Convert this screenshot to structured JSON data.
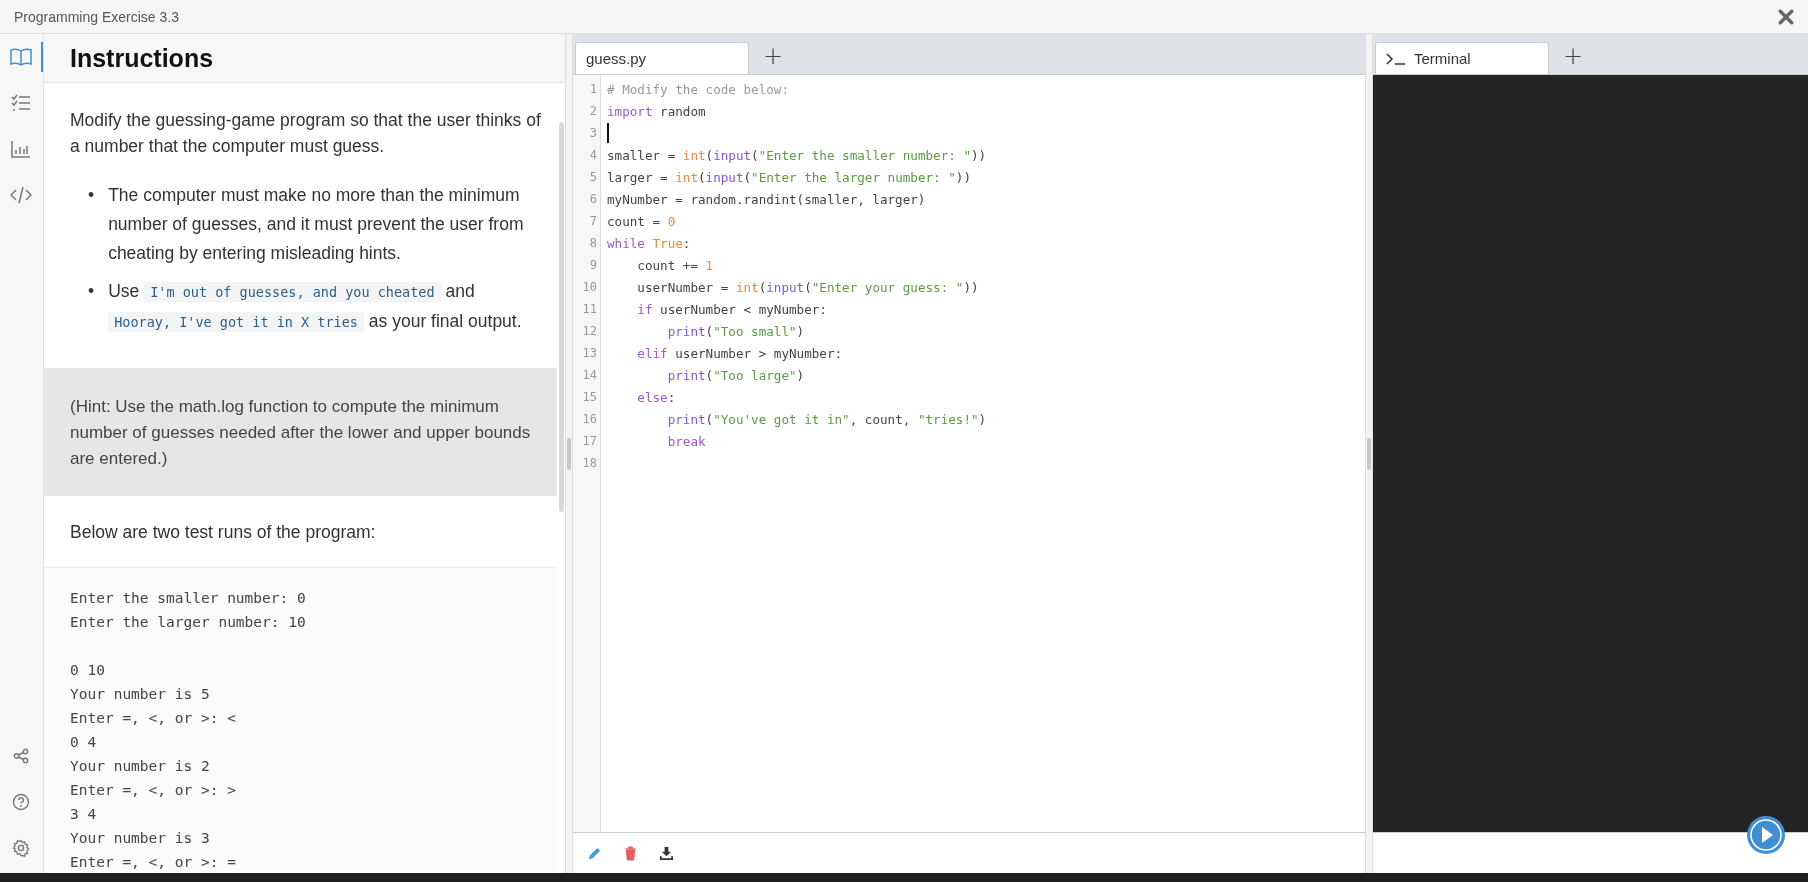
{
  "window": {
    "title": "Programming Exercise 3.3"
  },
  "rail": {
    "top": [
      {
        "kind": "book",
        "selected": true
      },
      {
        "kind": "checklist",
        "selected": false
      },
      {
        "kind": "chart",
        "selected": false
      },
      {
        "kind": "code",
        "selected": false
      }
    ],
    "bottom": [
      {
        "kind": "share",
        "selected": false
      },
      {
        "kind": "help",
        "selected": false
      },
      {
        "kind": "settings",
        "selected": false
      }
    ]
  },
  "instructions": {
    "title": "Instructions",
    "intro": "Modify the guessing-game program so that the user thinks of a number that the computer must guess.",
    "bullets": [
      {
        "marker": "•",
        "parts": [
          {
            "kind": "text",
            "text": "The computer must make no more than the minimum number of guesses, and it must prevent the user from cheating by entering misleading hints."
          }
        ]
      },
      {
        "marker": "•",
        "parts": [
          {
            "kind": "text",
            "text": "Use "
          },
          {
            "kind": "code",
            "text": "I'm out of guesses, and you cheated"
          },
          {
            "kind": "text",
            "text": " and "
          },
          {
            "kind": "code",
            "text": "Hooray, I've got it in X tries"
          },
          {
            "kind": "text",
            "text": " as your final output."
          }
        ]
      }
    ],
    "hint": "(Hint: Use the math.log function to compute the minimum number of guesses needed after the lower and upper bounds are entered.)",
    "runs_intro": "Below are two test runs of the program:",
    "output": [
      [
        "Enter the smaller number: 0",
        "Enter the larger number: 10"
      ],
      [
        "0 10",
        "Your number is 5",
        "Enter =, <, or >: <",
        "0 4",
        "Your number is 2",
        "Enter =, <, or >: >",
        "3 4",
        "Your number is 3",
        "Enter =, <, or >: ="
      ]
    ]
  },
  "editor": {
    "tabs": [
      {
        "label": "guess.py",
        "selected": true
      }
    ],
    "add_tab": "+",
    "lines": [
      {
        "number": "1",
        "cursor": false,
        "tokens": [
          {
            "kind": "comment",
            "text": "# Modify the code below:"
          }
        ]
      },
      {
        "number": "2",
        "cursor": false,
        "tokens": [
          {
            "kind": "keyword",
            "text": "import"
          },
          {
            "kind": "plain",
            "text": " random"
          }
        ]
      },
      {
        "number": "3",
        "cursor": true
      },
      {
        "number": "4",
        "cursor": false,
        "tokens": [
          {
            "kind": "plain",
            "text": "smaller = "
          },
          {
            "kind": "type",
            "text": "int"
          },
          {
            "kind": "plain",
            "text": "("
          },
          {
            "kind": "builtin",
            "text": "input"
          },
          {
            "kind": "plain",
            "text": "("
          },
          {
            "kind": "string",
            "text": "\"Enter the smaller number: \""
          },
          {
            "kind": "plain",
            "text": "))"
          }
        ]
      },
      {
        "number": "5",
        "cursor": false,
        "tokens": [
          {
            "kind": "plain",
            "text": "larger = "
          },
          {
            "kind": "type",
            "text": "int"
          },
          {
            "kind": "plain",
            "text": "("
          },
          {
            "kind": "builtin",
            "text": "input"
          },
          {
            "kind": "plain",
            "text": "("
          },
          {
            "kind": "string",
            "text": "\"Enter the larger number: \""
          },
          {
            "kind": "plain",
            "text": "))"
          }
        ]
      },
      {
        "number": "6",
        "cursor": false,
        "tokens": [
          {
            "kind": "plain",
            "text": "myNumber = random.randint(smaller, larger)"
          }
        ]
      },
      {
        "number": "7",
        "cursor": false,
        "tokens": [
          {
            "kind": "plain",
            "text": "count = "
          },
          {
            "kind": "number",
            "text": "0"
          }
        ]
      },
      {
        "number": "8",
        "cursor": false,
        "tokens": [
          {
            "kind": "keyword",
            "text": "while"
          },
          {
            "kind": "number",
            "text": " True"
          },
          {
            "kind": "plain",
            "text": ":"
          }
        ]
      },
      {
        "number": "9",
        "cursor": false,
        "tokens": [
          {
            "kind": "plain",
            "text": "    count += "
          },
          {
            "kind": "number",
            "text": "1"
          }
        ]
      },
      {
        "number": "10",
        "cursor": false,
        "tokens": [
          {
            "kind": "plain",
            "text": "    userNumber = "
          },
          {
            "kind": "type",
            "text": "int"
          },
          {
            "kind": "plain",
            "text": "("
          },
          {
            "kind": "builtin",
            "text": "input"
          },
          {
            "kind": "plain",
            "text": "("
          },
          {
            "kind": "string",
            "text": "\"Enter your guess: \""
          },
          {
            "kind": "plain",
            "text": "))"
          }
        ]
      },
      {
        "number": "11",
        "cursor": false,
        "tokens": [
          {
            "kind": "keyword",
            "text": "    if"
          },
          {
            "kind": "plain",
            "text": " userNumber < myNumber:"
          }
        ]
      },
      {
        "number": "12",
        "cursor": false,
        "tokens": [
          {
            "kind": "builtin",
            "text": "        print"
          },
          {
            "kind": "plain",
            "text": "("
          },
          {
            "kind": "string",
            "text": "\"Too small\""
          },
          {
            "kind": "plain",
            "text": ")"
          }
        ]
      },
      {
        "number": "13",
        "cursor": false,
        "tokens": [
          {
            "kind": "keyword",
            "text": "    elif"
          },
          {
            "kind": "plain",
            "text": " userNumber > myNumber:"
          }
        ]
      },
      {
        "number": "14",
        "cursor": false,
        "tokens": [
          {
            "kind": "builtin",
            "text": "        print"
          },
          {
            "kind": "plain",
            "text": "("
          },
          {
            "kind": "string",
            "text": "\"Too large\""
          },
          {
            "kind": "plain",
            "text": ")"
          }
        ]
      },
      {
        "number": "15",
        "cursor": false,
        "tokens": [
          {
            "kind": "keyword",
            "text": "    else"
          },
          {
            "kind": "plain",
            "text": ":"
          }
        ]
      },
      {
        "number": "16",
        "cursor": false,
        "tokens": [
          {
            "kind": "builtin",
            "text": "        print"
          },
          {
            "kind": "plain",
            "text": "("
          },
          {
            "kind": "string",
            "text": "\"You've got it in\""
          },
          {
            "kind": "plain",
            "text": ", count, "
          },
          {
            "kind": "string",
            "text": "\"tries!\""
          },
          {
            "kind": "plain",
            "text": ")"
          }
        ]
      },
      {
        "number": "17",
        "cursor": false,
        "tokens": [
          {
            "kind": "keyword",
            "text": "        break"
          }
        ]
      },
      {
        "number": "18",
        "cursor": false
      }
    ],
    "toolbar": [
      {
        "kind": "edit"
      },
      {
        "kind": "delete"
      },
      {
        "kind": "download"
      }
    ]
  },
  "terminal": {
    "tabs": [
      {
        "label": "Terminal",
        "selected": true
      }
    ],
    "add_tab": "+"
  }
}
